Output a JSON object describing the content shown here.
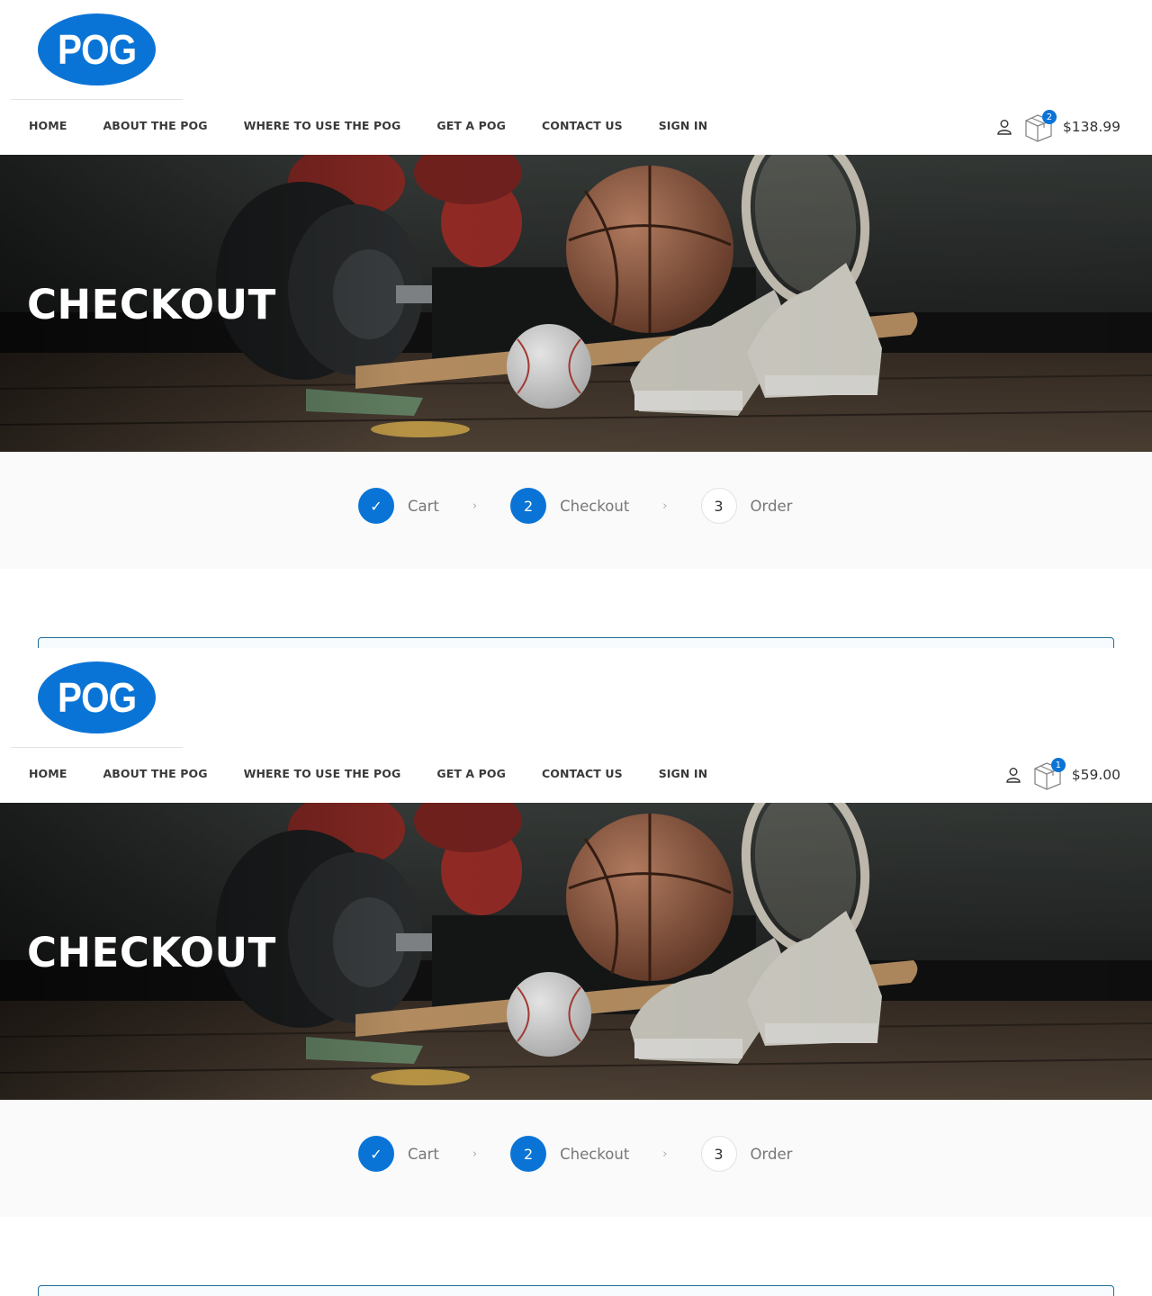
{
  "shots": [
    {
      "logo": "POG",
      "nav": [
        "HOME",
        "ABOUT THE POG",
        "WHERE TO USE THE POG",
        "GET A POG",
        "CONTACT US",
        "SIGN IN"
      ],
      "cart": {
        "count": "2",
        "total": "$138.99"
      },
      "hero_title": "CHECKOUT",
      "steps": [
        {
          "mark": "✓",
          "label": "Cart",
          "state": "done"
        },
        {
          "mark": "2",
          "label": "Checkout",
          "state": "active"
        },
        {
          "mark": "3",
          "label": "Order",
          "state": "idle"
        }
      ],
      "step_separator": "›"
    },
    {
      "logo": "POG",
      "nav": [
        "HOME",
        "ABOUT THE POG",
        "WHERE TO USE THE POG",
        "GET A POG",
        "CONTACT US",
        "SIGN IN"
      ],
      "cart": {
        "count": "1",
        "total": "$59.00"
      },
      "hero_title": "CHECKOUT",
      "steps": [
        {
          "mark": "✓",
          "label": "Cart",
          "state": "done"
        },
        {
          "mark": "2",
          "label": "Checkout",
          "state": "active"
        },
        {
          "mark": "3",
          "label": "Order",
          "state": "idle"
        }
      ],
      "step_separator": "›"
    }
  ],
  "colors": {
    "brand": "#0a74d6",
    "notice_border": "#1f6f94"
  },
  "icons": {
    "account": "user-icon",
    "cart": "box-icon",
    "done": "check-icon"
  }
}
